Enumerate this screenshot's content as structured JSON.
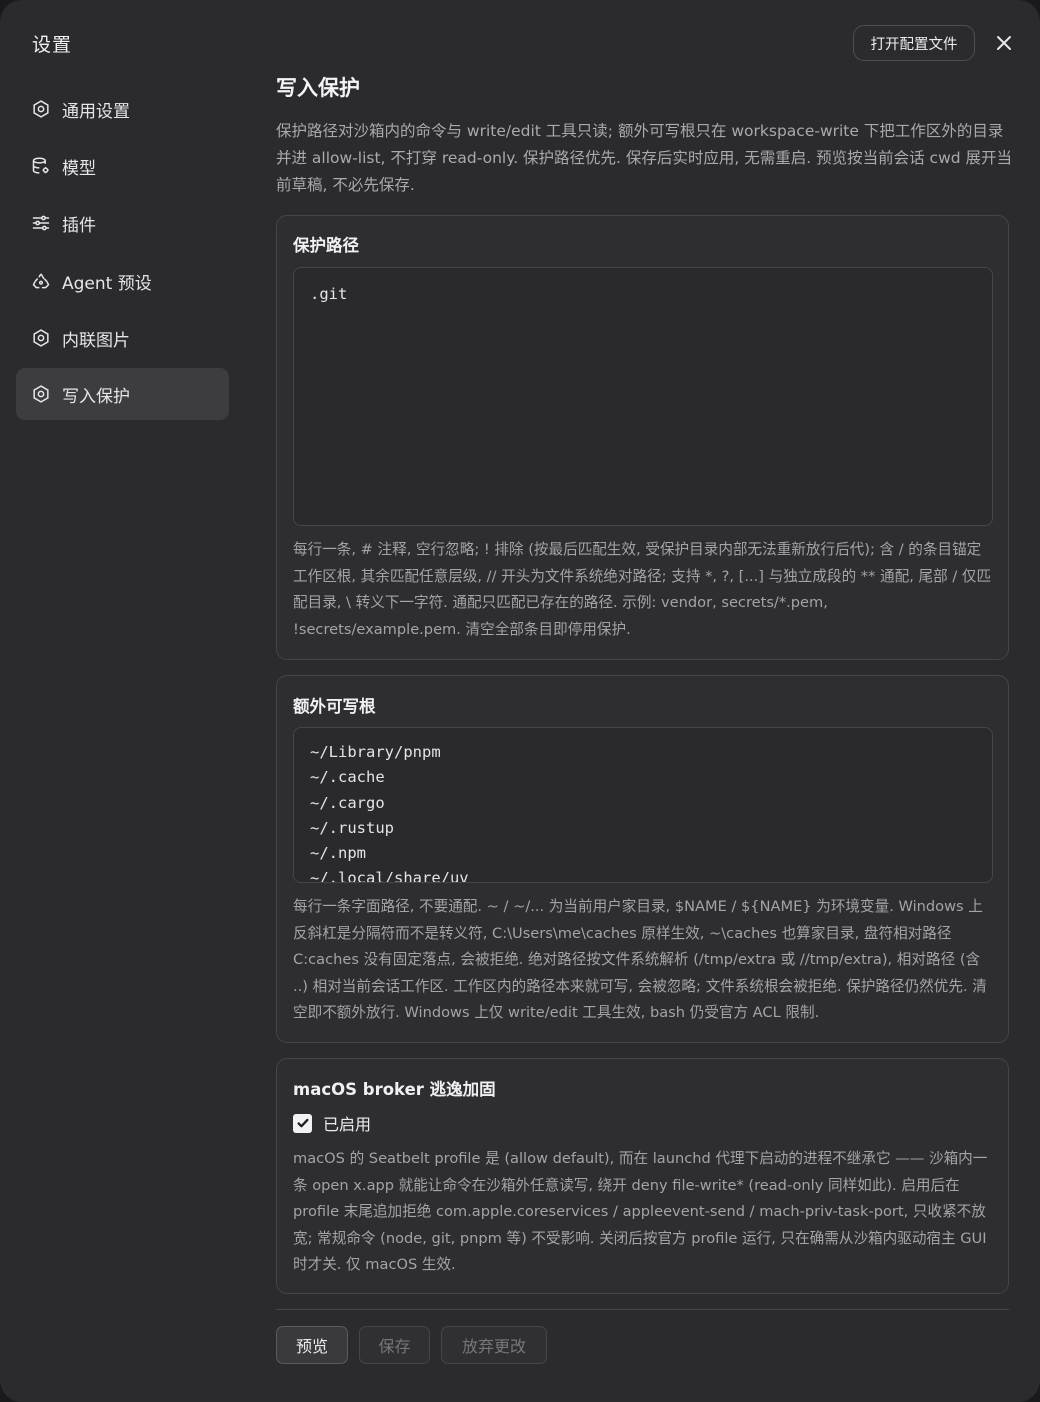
{
  "sidebar": {
    "title": "设置",
    "items": [
      {
        "label": "通用设置",
        "icon": "gear-icon"
      },
      {
        "label": "模型",
        "icon": "database-gear-icon"
      },
      {
        "label": "插件",
        "icon": "sliders-icon"
      },
      {
        "label": "Agent 预设",
        "icon": "recycle-icon"
      },
      {
        "label": "内联图片",
        "icon": "gear-icon"
      },
      {
        "label": "写入保护",
        "icon": "gear-icon",
        "active": true
      }
    ]
  },
  "header": {
    "open_config_label": "打开配置文件",
    "close_icon": "close-icon"
  },
  "main": {
    "title": "写入保护",
    "description": "保护路径对沙箱内的命令与 write/edit 工具只读; 额外可写根只在 workspace-write 下把工作区外的目录并进 allow-list, 不打穿 read-only. 保护路径优先. 保存后实时应用, 无需重启. 预览按当前会话 cwd 展开当前草稿, 不必先保存.",
    "protected": {
      "title": "保护路径",
      "value": ".git",
      "help": "每行一条, # 注释, 空行忽略; ! 排除 (按最后匹配生效, 受保护目录内部无法重新放行后代); 含 / 的条目锚定工作区根, 其余匹配任意层级, // 开头为文件系统绝对路径; 支持 *, ?, [...] 与独立成段的 ** 通配, 尾部 / 仅匹配目录, \\ 转义下一字符. 通配只匹配已存在的路径. 示例: vendor, secrets/*.pem, !secrets/example.pem. 清空全部条目即停用保护."
    },
    "writable": {
      "title": "额外可写根",
      "lines": [
        "~/Library/pnpm",
        "~/.cache",
        "~/.cargo",
        "~/.rustup",
        "~/.npm",
        "~/.local/share/uv"
      ],
      "help": "每行一条字面路径, 不要通配. ~ / ~/... 为当前用户家目录, $NAME / ${NAME} 为环境变量. Windows 上反斜杠是分隔符而不是转义符, C:\\Users\\me\\caches 原样生效, ~\\caches 也算家目录, 盘符相对路径 C:caches 没有固定落点, 会被拒绝. 绝对路径按文件系统解析 (/tmp/extra 或 //tmp/extra), 相对路径 (含 ..) 相对当前会话工作区. 工作区内的路径本来就可写, 会被忽略; 文件系统根会被拒绝. 保护路径仍然优先. 清空即不额外放行. Windows 上仅 write/edit 工具生效, bash 仍受官方 ACL 限制."
    },
    "broker": {
      "title": "macOS broker 逃逸加固",
      "enabled_label": "已启用",
      "enabled": true,
      "help": "macOS 的 Seatbelt profile 是 (allow default), 而在 launchd 代理下启动的进程不继承它 —— 沙箱内一条 open x.app 就能让命令在沙箱外任意读写, 绕开 deny file-write* (read-only 同样如此). 启用后在 profile 末尾追加拒绝 com.apple.coreservices / appleevent-send / mach-priv-task-port, 只收紧不放宽; 常规命令 (node, git, pnpm 等) 不受影响. 关闭后按官方 profile 运行, 只在确需从沙箱内驱动宿主 GUI 时才关. 仅 macOS 生效."
    }
  },
  "footer": {
    "preview_label": "预览",
    "save_label": "保存",
    "discard_label": "放弃更改"
  }
}
